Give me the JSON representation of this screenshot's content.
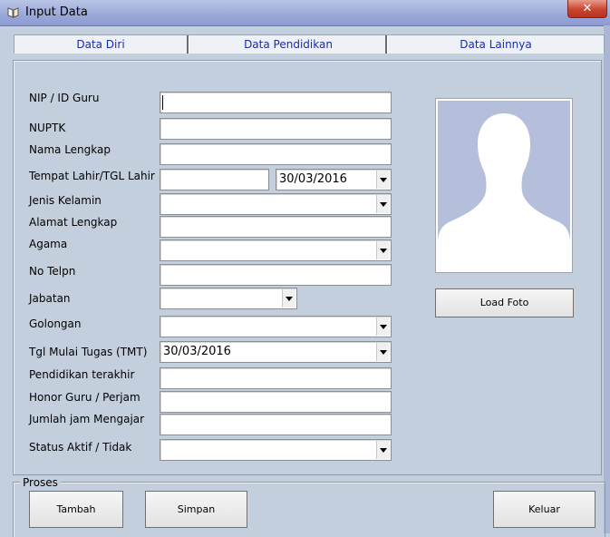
{
  "window": {
    "title": "Input Data",
    "close_label": "x"
  },
  "tabs": [
    {
      "label": "Data Diri"
    },
    {
      "label": "Data Pendidikan"
    },
    {
      "label": "Data Lainnya"
    }
  ],
  "form": {
    "nip": {
      "label": "NIP / ID Guru",
      "value": ""
    },
    "nuptk": {
      "label": "NUPTK",
      "value": ""
    },
    "nama": {
      "label": "Nama Lengkap",
      "value": ""
    },
    "ttl": {
      "label": "Tempat Lahir/TGL Lahir",
      "tempat": "",
      "tanggal": "30/03/2016"
    },
    "jenis_kelamin": {
      "label": "Jenis Kelamin",
      "value": ""
    },
    "alamat": {
      "label": "Alamat Lengkap",
      "value": ""
    },
    "agama": {
      "label": "Agama",
      "value": ""
    },
    "telp": {
      "label": "No Telpn",
      "value": ""
    },
    "jabatan": {
      "label": "Jabatan",
      "value": ""
    },
    "golongan": {
      "label": "Golongan",
      "value": ""
    },
    "tmt": {
      "label": "Tgl Mulai Tugas (TMT)",
      "value": "30/03/2016"
    },
    "pendidikan": {
      "label": "Pendidikan terakhir",
      "value": ""
    },
    "honor": {
      "label": "Honor Guru / Perjam",
      "value": ""
    },
    "jam": {
      "label": "Jumlah jam Mengajar",
      "value": ""
    },
    "status": {
      "label": "Status Aktif / Tidak",
      "value": ""
    }
  },
  "photo": {
    "icon": "person-silhouette-icon",
    "load_label": "Load Foto"
  },
  "proses": {
    "label": "Proses",
    "tambah": "Tambah",
    "simpan": "Simpan",
    "keluar": "Keluar"
  },
  "colors": {
    "background": "#c4cfdd",
    "tab_text": "#1a2bb0",
    "photo_bg": "#b5bfdb"
  }
}
